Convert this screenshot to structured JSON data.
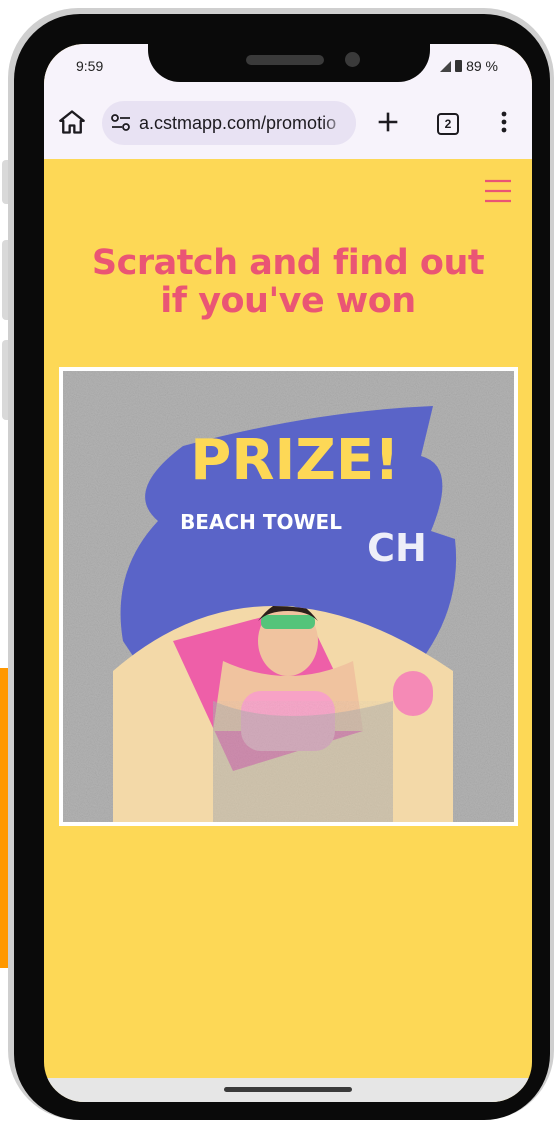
{
  "status_bar": {
    "time": "9:59",
    "battery": "89 %"
  },
  "browser": {
    "url": "a.cstmapp.com/promotio",
    "tab_count": "2"
  },
  "page": {
    "headline_line1": "Scratch and find out",
    "headline_line2": "if you've won"
  },
  "scratch_card": {
    "prize_title": "PRIZE!",
    "prize_name": "BEACH TOWEL",
    "scratched_partial_text": "CH"
  },
  "colors": {
    "page_background": "#fdd856",
    "headline": "#ea5574",
    "brush_stroke": "#5a64c8",
    "prize_title": "#fdd856",
    "scratch_coating": "#b4b4b4",
    "accent_orange": "#ff9800"
  },
  "icons": {
    "home": "home-icon",
    "site_settings": "tune-icon",
    "new_tab": "plus-icon",
    "tabs": "tab-counter-icon",
    "more": "more-vert-icon",
    "menu": "hamburger-icon"
  }
}
